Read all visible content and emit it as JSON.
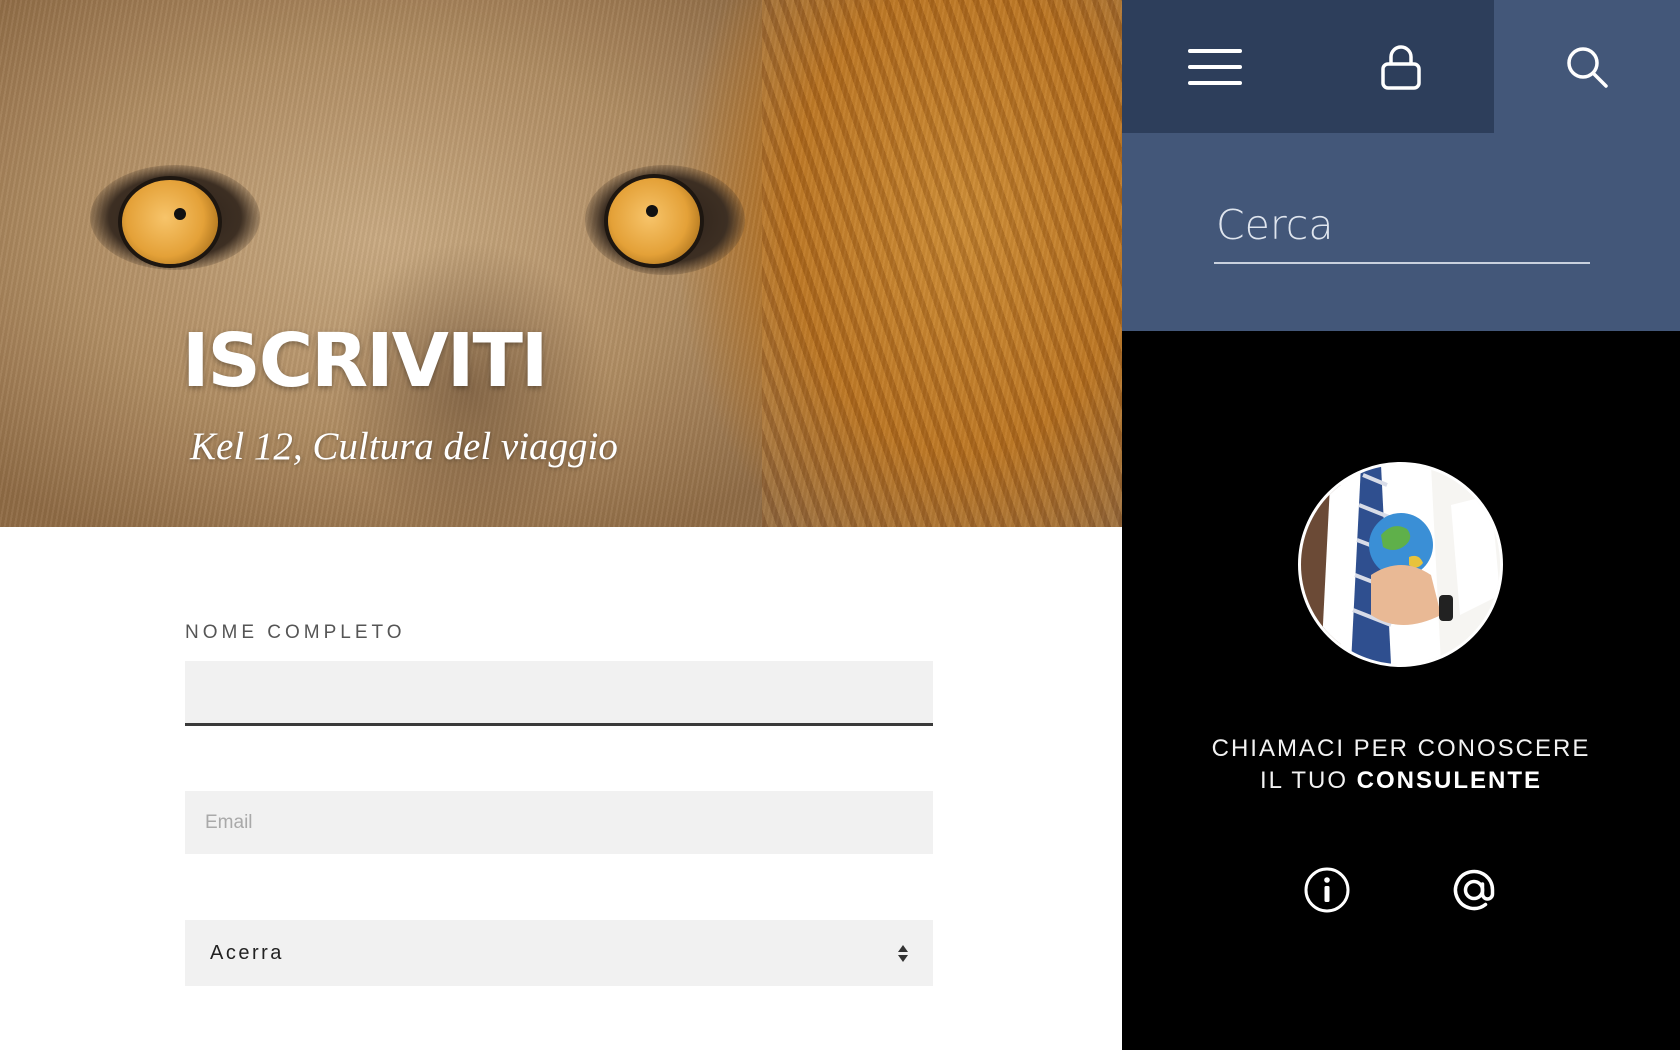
{
  "hero": {
    "title": "ISCRIVITI",
    "subtitle": "Kel 12, Cultura del viaggio"
  },
  "form": {
    "full_name_label": "NOME COMPLETO",
    "full_name_value": "",
    "email_placeholder": "Email",
    "email_value": "",
    "city_select": {
      "selected": "Acerra",
      "options": [
        "Acerra"
      ]
    }
  },
  "side": {
    "icons": {
      "menu": "hamburger-menu-icon",
      "lock": "lock-icon",
      "search": "search-icon",
      "info": "info-icon",
      "email": "at-sign-icon"
    },
    "search": {
      "placeholder": "Cerca",
      "value": ""
    },
    "cta": {
      "line1": "CHIAMACI PER CONOSCERE",
      "line2_prefix": "IL TUO",
      "line2_strong": "CONSULENTE"
    }
  },
  "colors": {
    "panel_blue": "#435779",
    "panel_dark_blue": "#2d3e5b",
    "panel_black": "#000000",
    "input_bg": "#f1f1f1"
  }
}
